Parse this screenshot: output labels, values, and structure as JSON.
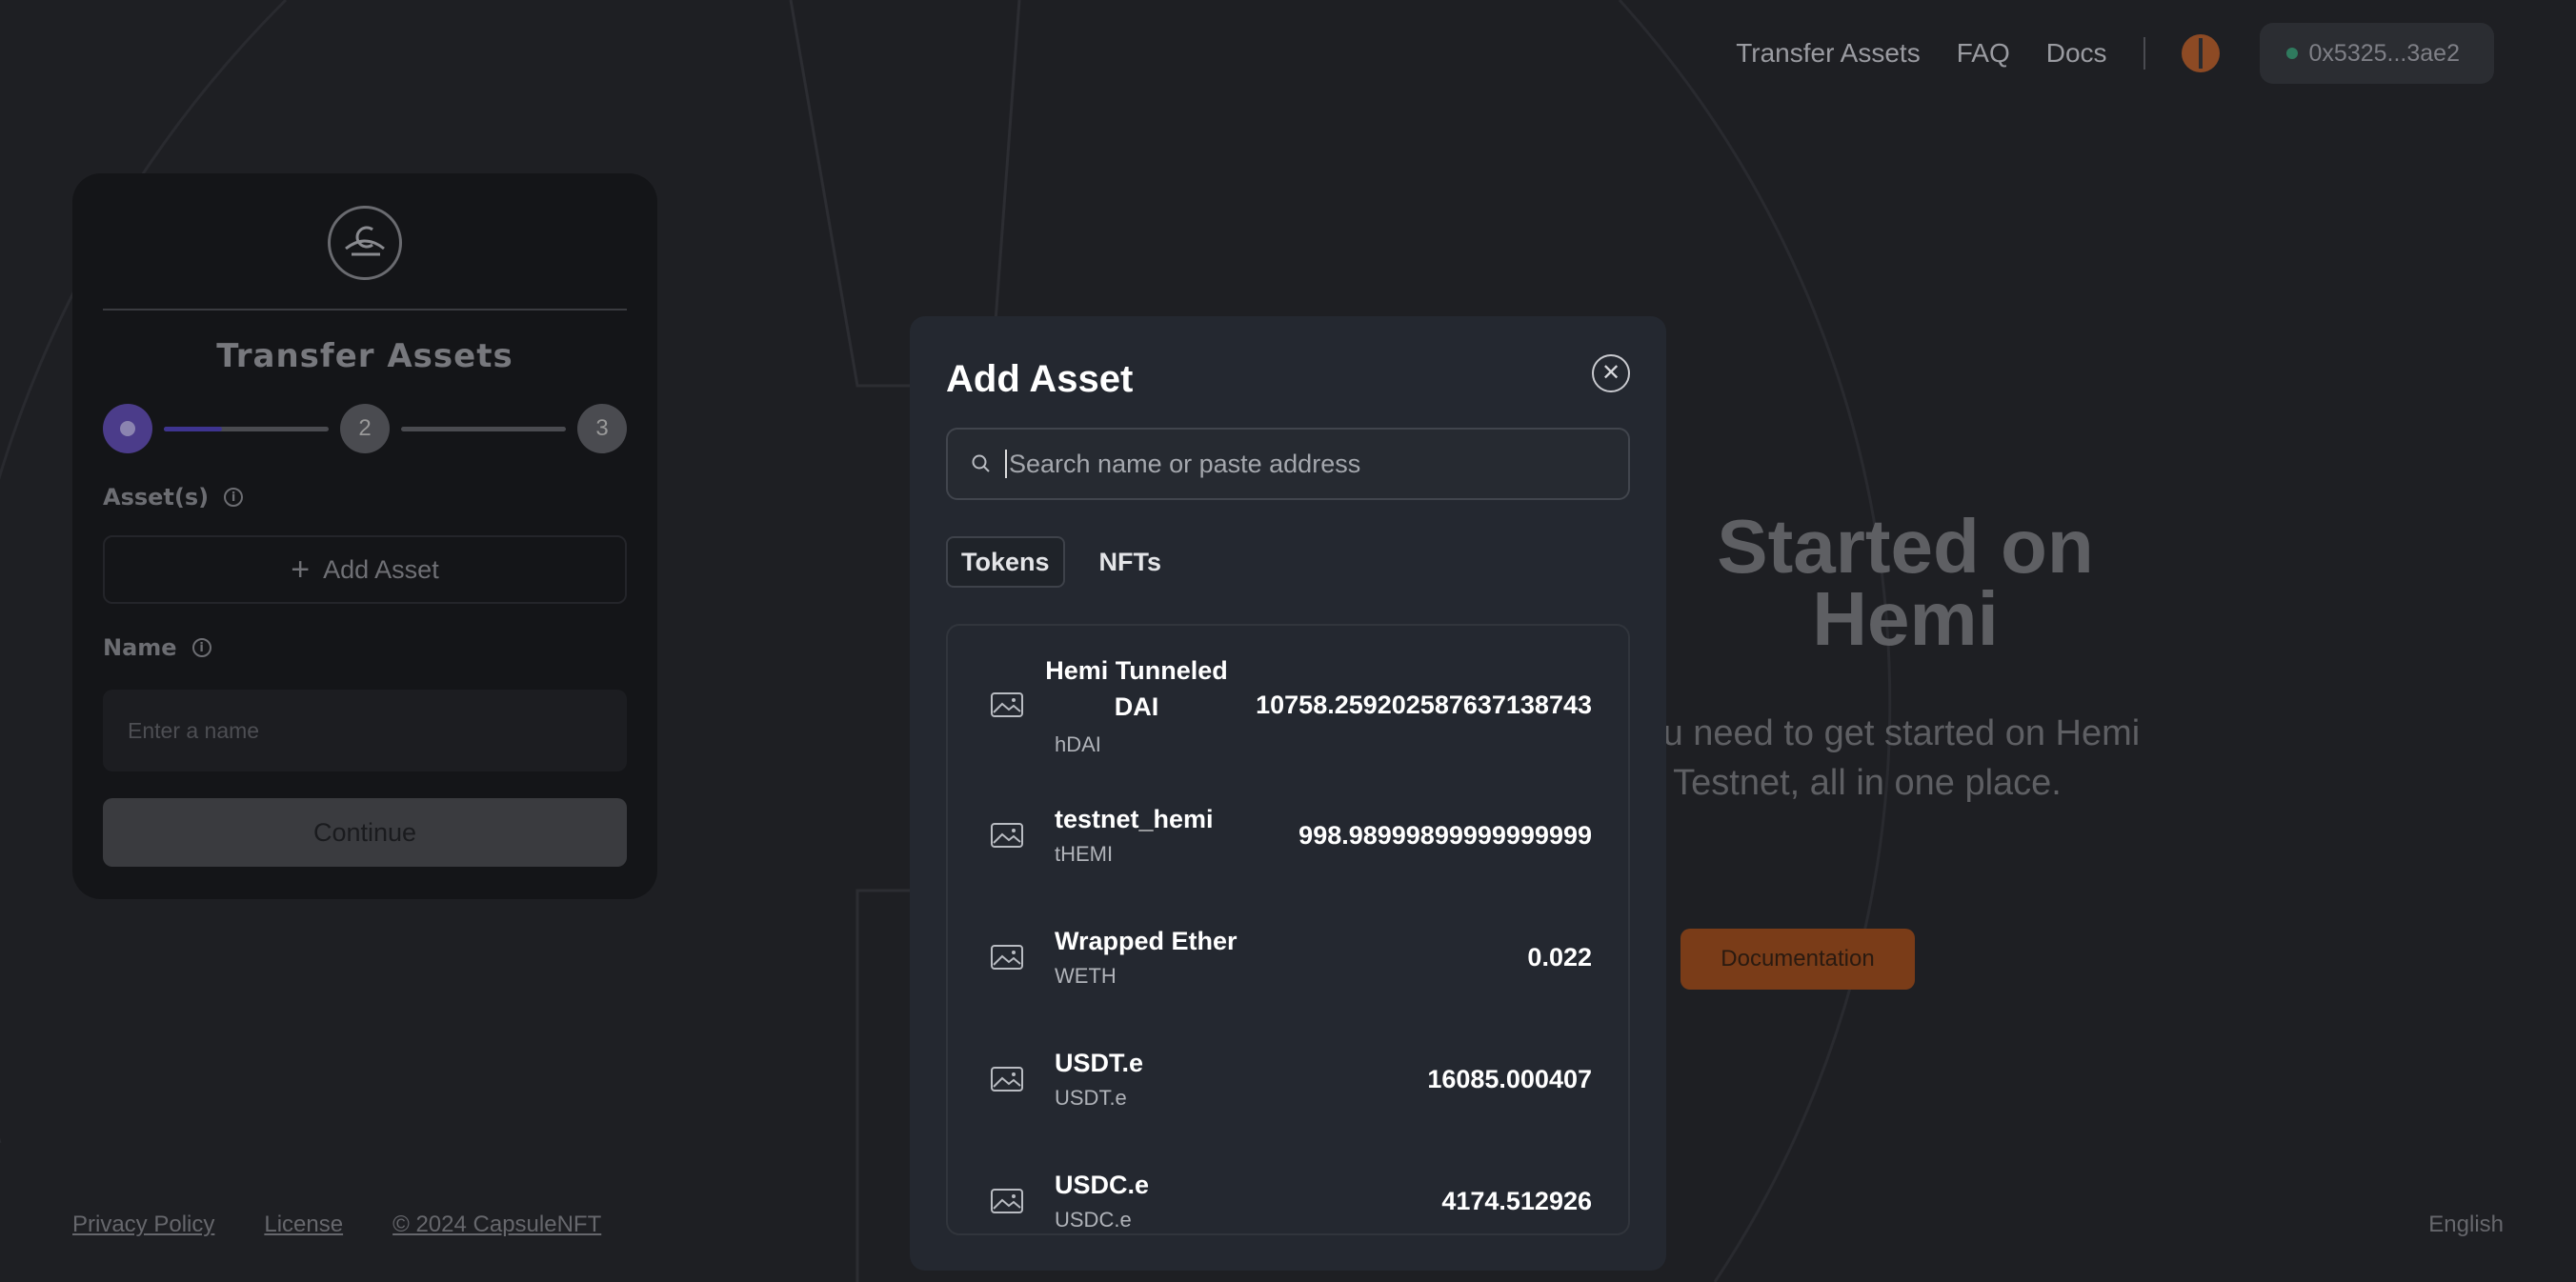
{
  "nav": {
    "links": [
      "Transfer Assets",
      "FAQ",
      "Docs"
    ],
    "wallet": "0x5325...3ae2"
  },
  "card": {
    "title": "Transfer Assets",
    "steps": [
      "",
      "2",
      "3"
    ],
    "assets_label": "Asset(s)",
    "add_asset_label": "Add Asset",
    "name_label": "Name",
    "name_placeholder": "Enter a name",
    "continue_label": "Continue"
  },
  "hero": {
    "title": "Started on Hemi",
    "subtitle": "g you need to get started on Hemi Testnet, all in one place.",
    "doc_button": "Documentation"
  },
  "footer": {
    "links": [
      "Privacy Policy",
      "License",
      "© 2024 CapsuleNFT"
    ],
    "language": "English"
  },
  "modal": {
    "title": "Add Asset",
    "search_placeholder": "Search name or paste address",
    "tabs": [
      "Tokens",
      "NFTs"
    ],
    "tokens": [
      {
        "name": "Hemi Tunneled DAI",
        "symbol": "hDAI",
        "balance": "10758.259202587637138743"
      },
      {
        "name": "testnet_hemi",
        "symbol": "tHEMI",
        "balance": "998.98999899999999999"
      },
      {
        "name": "Wrapped Ether",
        "symbol": "WETH",
        "balance": "0.022"
      },
      {
        "name": "USDT.e",
        "symbol": "USDT.e",
        "balance": "16085.000407"
      },
      {
        "name": "USDC.e",
        "symbol": "USDC.e",
        "balance": "4174.512926"
      }
    ]
  },
  "colors": {
    "background": "#1e1f23",
    "modal": "#242830",
    "accent_purple": "#4b3c8a",
    "accent_orange": "#7a3c18"
  }
}
